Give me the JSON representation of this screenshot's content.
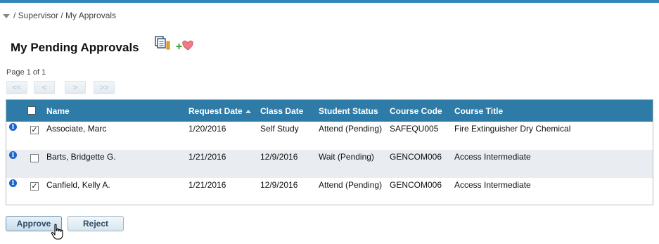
{
  "breadcrumb": {
    "text": "/ Supervisor / My Approvals"
  },
  "page": {
    "title": "My Pending Approvals"
  },
  "pager": {
    "text": "Page 1 of 1",
    "first": "<<",
    "prev": "<",
    "next": ">",
    "last": ">>"
  },
  "table": {
    "columns": {
      "name": "Name",
      "request_date": "Request Date",
      "class_date": "Class Date",
      "student_status": "Student Status",
      "course_code": "Course Code",
      "course_title": "Course Title"
    },
    "rows": [
      {
        "name": "Associate, Marc",
        "request_date": "1/20/2016",
        "class_date": "Self Study",
        "student_status": "Attend (Pending)",
        "course_code": "SAFEQU005",
        "course_title": "Fire Extinguisher Dry Chemical",
        "checked": true
      },
      {
        "name": "Barts, Bridgette G.",
        "request_date": "1/21/2016",
        "class_date": "12/9/2016",
        "student_status": "Wait (Pending)",
        "course_code": "GENCOM006",
        "course_title": "Access Intermediate",
        "checked": false
      },
      {
        "name": "Canfield, Kelly A.",
        "request_date": "1/21/2016",
        "class_date": "12/9/2016",
        "student_status": "Attend (Pending)",
        "course_code": "GENCOM006",
        "course_title": "Access Intermediate",
        "checked": true
      }
    ]
  },
  "actions": {
    "approve": "Approve",
    "reject": "Reject"
  },
  "colors": {
    "accent": "#2e87b7",
    "header": "#2e7ba7",
    "info": "#1b67c9"
  }
}
